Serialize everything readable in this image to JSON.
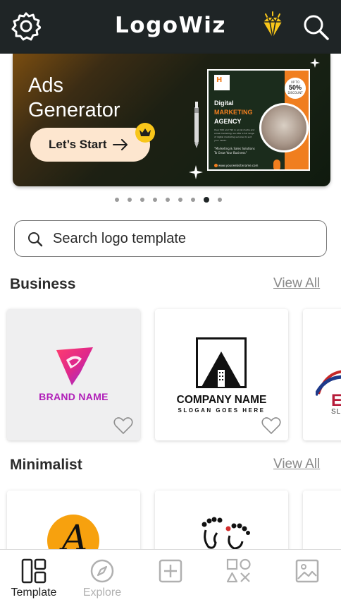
{
  "header": {
    "title": "LogoWiz",
    "left_icon": "gear-icon",
    "premium_icon": "diamond-icon",
    "right_icon": "search-icon"
  },
  "banner": {
    "title_line1": "Ads",
    "title_line2": "Generator",
    "cta_label": "Let’s Start",
    "cta_arrow": "→",
    "badge_icon": "crown-icon",
    "flyer": {
      "brand": "Company",
      "headline1": "Digital",
      "headline2": "MARKETING",
      "headline3": "AGENCY",
      "offer_up": "UP TO",
      "offer_pct": "50%",
      "offer_off": "DISCOUNT",
      "body": "Over 500 and 790 in social media and email marketing, we offer a full range of digital marketing services to suit your needs.",
      "tagline": "\"Marketing & Sales Solutions To Grow Your Business\"",
      "website": "www.yourwebsitename.com"
    }
  },
  "carousel": {
    "count": 9,
    "active_index": 7
  },
  "search": {
    "placeholder": "Search logo template"
  },
  "sections": [
    {
      "title": "Business",
      "view_all": "View All",
      "cards": [
        {
          "type": "brand",
          "text": "BRAND NAME"
        },
        {
          "type": "company",
          "text": "COMPANY NAME",
          "slogan": "SLOGAN GOES HERE"
        },
        {
          "type": "partial",
          "text": "E",
          "slogan": "SL"
        }
      ]
    },
    {
      "title": "Minimalist",
      "view_all": "View All",
      "cards": [
        {
          "type": "letter",
          "text": "A"
        },
        {
          "type": "footprint"
        },
        {
          "type": "blank"
        }
      ]
    }
  ],
  "bottom_nav": [
    {
      "label": "Template",
      "icon": "template-grid-icon",
      "active": true
    },
    {
      "label": "Explore",
      "icon": "compass-icon",
      "active": false
    },
    {
      "label": "",
      "icon": "add-square-icon",
      "active": false
    },
    {
      "label": "",
      "icon": "shapes-icon",
      "active": false
    },
    {
      "label": "",
      "icon": "image-icon",
      "active": false
    }
  ],
  "colors": {
    "header_bg": "#1f2526",
    "accent_orange": "#f07e1f",
    "premium_yellow": "#f8c61a",
    "brand_purple": "#b01eb8"
  }
}
